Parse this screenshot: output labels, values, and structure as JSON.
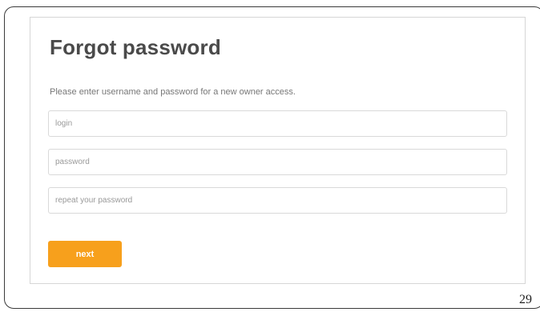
{
  "form": {
    "title": "Forgot password",
    "description": "Please enter username and password for a new owner access.",
    "login_placeholder": "login",
    "password_placeholder": "password",
    "repeat_placeholder": "repeat your password",
    "next_label": "next"
  },
  "page_number": "29",
  "colors": {
    "accent": "#f7a01c",
    "title": "#4a4a4a"
  }
}
